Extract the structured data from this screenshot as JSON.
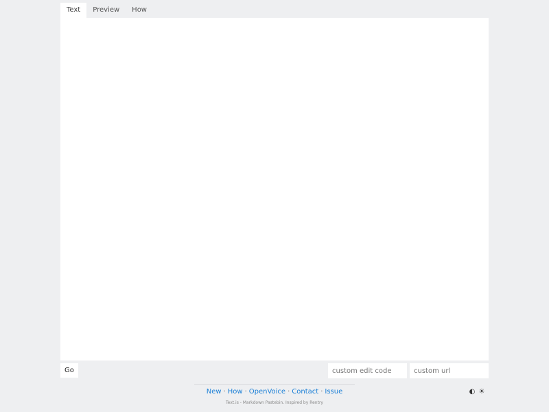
{
  "tabs": [
    {
      "label": "Text",
      "active": true
    },
    {
      "label": "Preview",
      "active": false
    },
    {
      "label": "How",
      "active": false
    }
  ],
  "editor": {
    "value": ""
  },
  "actions": {
    "go_label": "Go",
    "edit_code_placeholder": "custom edit code",
    "custom_url_placeholder": "custom url"
  },
  "footer": {
    "links": [
      "New",
      "How",
      "OpenVoice",
      "Contact",
      "Issue"
    ],
    "separator": "·",
    "note": "Text.is - Markdown Pastebin. Inspired by Rentry"
  },
  "theme": {
    "auto_icon": "half-circle-icon",
    "light_icon": "sun-icon",
    "auto_glyph": "◐",
    "light_glyph": "☀"
  },
  "colors": {
    "background": "#eeeff1",
    "link": "#1a7fd6",
    "panel": "#ffffff"
  }
}
